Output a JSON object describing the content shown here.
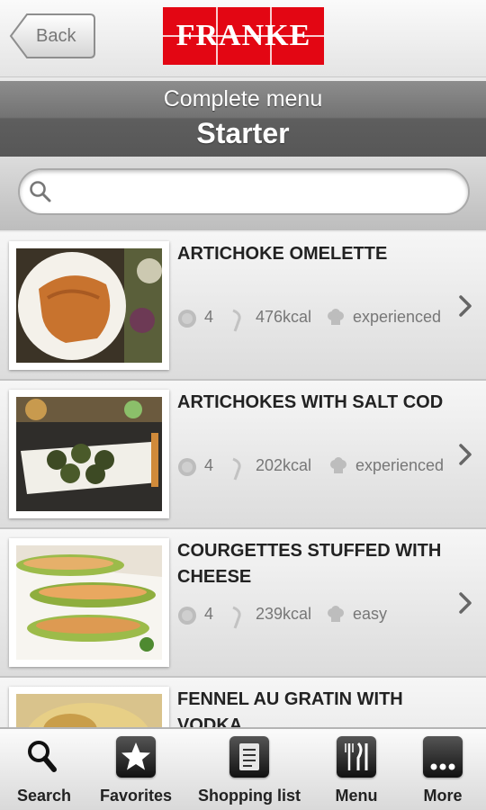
{
  "header": {
    "back_label": "Back",
    "brand": "FRANKE",
    "brand_color": "#e30613"
  },
  "titlebar": {
    "subtitle": "Complete menu",
    "title": "Starter"
  },
  "search": {
    "placeholder": "",
    "value": "",
    "icon": "search-icon"
  },
  "recipes": [
    {
      "title": "ARTICHOKE OMELETTE",
      "servings": "4",
      "kcal": "476kcal",
      "difficulty": "experienced"
    },
    {
      "title": "ARTICHOKES WITH SALT COD",
      "servings": "4",
      "kcal": "202kcal",
      "difficulty": "experienced"
    },
    {
      "title": "COURGETTES STUFFED WITH CHEESE",
      "servings": "4",
      "kcal": "239kcal",
      "difficulty": "easy"
    },
    {
      "title": "FENNEL AU GRATIN WITH VODKA",
      "servings": "",
      "kcal": "",
      "difficulty": ""
    }
  ],
  "nav": [
    {
      "label": "Search",
      "icon": "search-icon"
    },
    {
      "label": "Favorites",
      "icon": "star-icon"
    },
    {
      "label": "Shopping list",
      "icon": "shopping-list-icon"
    },
    {
      "label": "Menu",
      "icon": "cutlery-icon"
    },
    {
      "label": "More",
      "icon": "more-icon"
    }
  ]
}
